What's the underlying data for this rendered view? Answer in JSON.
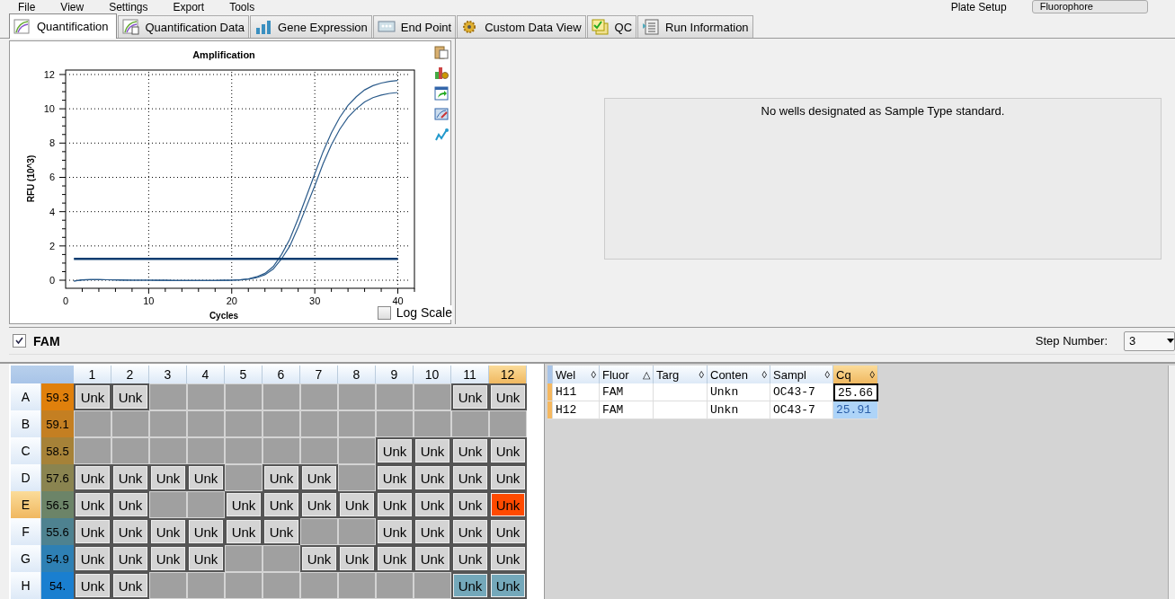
{
  "menu": [
    "File",
    "View",
    "Settings",
    "Export",
    "Tools"
  ],
  "plate_setup": "Plate Setup",
  "fluorophore": "Fluorophore",
  "tabs": [
    {
      "label": "Quantification",
      "selected": true
    },
    {
      "label": "Quantification Data",
      "selected": false
    },
    {
      "label": "Gene Expression",
      "selected": false
    },
    {
      "label": "End Point",
      "selected": false
    },
    {
      "label": "Custom Data View",
      "selected": false
    },
    {
      "label": "QC",
      "selected": false
    },
    {
      "label": "Run Information",
      "selected": false
    }
  ],
  "chart": {
    "log_scale": {
      "label": "Log Scale",
      "checked": false
    },
    "chart_data": {
      "type": "line",
      "title": "Amplification",
      "xlabel": "Cycles",
      "ylabel": "RFU (10^3)",
      "x": [
        1,
        2,
        3,
        4,
        5,
        6,
        7,
        8,
        9,
        10,
        11,
        12,
        13,
        14,
        15,
        16,
        17,
        18,
        19,
        20,
        21,
        22,
        23,
        24,
        25,
        26,
        27,
        28,
        29,
        30,
        31,
        32,
        33,
        34,
        35,
        36,
        37,
        38,
        39,
        40
      ],
      "grid": true,
      "xlim": [
        0,
        42
      ],
      "ylim": [
        -0.47,
        12.26
      ],
      "xticks": [
        0,
        10,
        20,
        30,
        40
      ],
      "yticks": [
        0,
        2,
        4,
        6,
        8,
        10,
        12
      ],
      "series": [
        {
          "color": "#2a5a8a",
          "values": [
            -0.05,
            0.02,
            0.04,
            0.04,
            0.03,
            0.02,
            0.01,
            0,
            0,
            0,
            -0.01,
            -0.01,
            -0.02,
            -0.02,
            -0.02,
            -0.02,
            -0.02,
            -0.02,
            -0.01,
            0,
            0.02,
            0.08,
            0.2,
            0.4,
            0.8,
            1.5,
            2.4,
            3.6,
            4.9,
            6.2,
            7.5,
            8.6,
            9.5,
            10.2,
            10.7,
            11.1,
            11.35,
            11.5,
            11.6,
            11.65
          ]
        },
        {
          "color": "#2a5a8a",
          "values": [
            -0.05,
            0.02,
            0.04,
            0.04,
            0.03,
            0.02,
            0.01,
            0,
            0,
            0,
            -0.01,
            -0.01,
            -0.02,
            -0.02,
            -0.02,
            -0.02,
            -0.02,
            -0.02,
            -0.01,
            0,
            0.02,
            0.06,
            0.15,
            0.32,
            0.65,
            1.25,
            2.0,
            3.1,
            4.3,
            5.5,
            6.8,
            7.9,
            8.8,
            9.5,
            10.0,
            10.4,
            10.65,
            10.8,
            10.9,
            10.95
          ]
        },
        {
          "color": "#0d3d70",
          "values": [
            1.25,
            1.25,
            1.25,
            1.25,
            1.25,
            1.25,
            1.25,
            1.25,
            1.25,
            1.25,
            1.25,
            1.25,
            1.25,
            1.25,
            1.25,
            1.25,
            1.25,
            1.25,
            1.25,
            1.25,
            1.25,
            1.25,
            1.25,
            1.25,
            1.25,
            1.25,
            1.25,
            1.25,
            1.25,
            1.25,
            1.25,
            1.25,
            1.25,
            1.25,
            1.25,
            1.25,
            1.25,
            1.25,
            1.25,
            1.25
          ]
        }
      ]
    }
  },
  "standard_message": "No wells designated as Sample Type standard.",
  "fluor_filter": {
    "label": "FAM",
    "checked": true
  },
  "step_number": {
    "label": "Step Number:",
    "value": "3"
  },
  "plate": {
    "columns": [
      {
        "label": "1",
        "selected": false
      },
      {
        "label": "2",
        "selected": false
      },
      {
        "label": "3",
        "selected": false
      },
      {
        "label": "4",
        "selected": false
      },
      {
        "label": "5",
        "selected": false
      },
      {
        "label": "6",
        "selected": false
      },
      {
        "label": "7",
        "selected": false
      },
      {
        "label": "8",
        "selected": false
      },
      {
        "label": "9",
        "selected": false
      },
      {
        "label": "10",
        "selected": false
      },
      {
        "label": "11",
        "selected": false
      },
      {
        "label": "12",
        "selected": true
      }
    ],
    "rows": [
      {
        "label": "A",
        "selected": false,
        "temp": "59.3",
        "color": "#e0800c",
        "wells": [
          {
            "kind": "sample",
            "label": "Unk",
            "selected": false,
            "focused": false
          },
          {
            "kind": "sample",
            "label": "Unk",
            "selected": false,
            "focused": false
          },
          {
            "kind": "empty"
          },
          {
            "kind": "empty"
          },
          {
            "kind": "empty"
          },
          {
            "kind": "empty"
          },
          {
            "kind": "empty"
          },
          {
            "kind": "empty"
          },
          {
            "kind": "empty"
          },
          {
            "kind": "empty"
          },
          {
            "kind": "sample",
            "label": "Unk",
            "selected": false,
            "focused": false
          },
          {
            "kind": "sample",
            "label": "Unk",
            "selected": false,
            "focused": false
          }
        ]
      },
      {
        "label": "B",
        "selected": false,
        "temp": "59.1",
        "color": "#c47f22",
        "wells": [
          {
            "kind": "empty"
          },
          {
            "kind": "empty"
          },
          {
            "kind": "empty"
          },
          {
            "kind": "empty"
          },
          {
            "kind": "empty"
          },
          {
            "kind": "empty"
          },
          {
            "kind": "empty"
          },
          {
            "kind": "empty"
          },
          {
            "kind": "empty"
          },
          {
            "kind": "empty"
          },
          {
            "kind": "empty"
          },
          {
            "kind": "empty"
          }
        ]
      },
      {
        "label": "C",
        "selected": false,
        "temp": "58.5",
        "color": "#a68238",
        "wells": [
          {
            "kind": "empty"
          },
          {
            "kind": "empty"
          },
          {
            "kind": "empty"
          },
          {
            "kind": "empty"
          },
          {
            "kind": "empty"
          },
          {
            "kind": "empty"
          },
          {
            "kind": "empty"
          },
          {
            "kind": "empty"
          },
          {
            "kind": "sample",
            "label": "Unk",
            "selected": false,
            "focused": false
          },
          {
            "kind": "sample",
            "label": "Unk",
            "selected": false,
            "focused": false
          },
          {
            "kind": "sample",
            "label": "Unk",
            "selected": false,
            "focused": false
          },
          {
            "kind": "sample",
            "label": "Unk",
            "selected": false,
            "focused": false
          }
        ]
      },
      {
        "label": "D",
        "selected": false,
        "temp": "57.6",
        "color": "#8a8450",
        "wells": [
          {
            "kind": "sample",
            "label": "Unk",
            "selected": false,
            "focused": false
          },
          {
            "kind": "sample",
            "label": "Unk",
            "selected": false,
            "focused": false
          },
          {
            "kind": "sample",
            "label": "Unk",
            "selected": false,
            "focused": false
          },
          {
            "kind": "sample",
            "label": "Unk",
            "selected": false,
            "focused": false
          },
          {
            "kind": "empty"
          },
          {
            "kind": "sample",
            "label": "Unk",
            "selected": false,
            "focused": false
          },
          {
            "kind": "sample",
            "label": "Unk",
            "selected": false,
            "focused": false
          },
          {
            "kind": "empty"
          },
          {
            "kind": "sample",
            "label": "Unk",
            "selected": false,
            "focused": false
          },
          {
            "kind": "sample",
            "label": "Unk",
            "selected": false,
            "focused": false
          },
          {
            "kind": "sample",
            "label": "Unk",
            "selected": false,
            "focused": false
          },
          {
            "kind": "sample",
            "label": "Unk",
            "selected": false,
            "focused": false
          }
        ]
      },
      {
        "label": "E",
        "selected": true,
        "temp": "56.5",
        "color": "#6c8468",
        "wells": [
          {
            "kind": "sample",
            "label": "Unk",
            "selected": false,
            "focused": false
          },
          {
            "kind": "sample",
            "label": "Unk",
            "selected": false,
            "focused": false
          },
          {
            "kind": "empty"
          },
          {
            "kind": "empty"
          },
          {
            "kind": "sample",
            "label": "Unk",
            "selected": false,
            "focused": false
          },
          {
            "kind": "sample",
            "label": "Unk",
            "selected": false,
            "focused": false
          },
          {
            "kind": "sample",
            "label": "Unk",
            "selected": false,
            "focused": false
          },
          {
            "kind": "sample",
            "label": "Unk",
            "selected": false,
            "focused": false
          },
          {
            "kind": "sample",
            "label": "Unk",
            "selected": false,
            "focused": false
          },
          {
            "kind": "sample",
            "label": "Unk",
            "selected": false,
            "focused": false
          },
          {
            "kind": "sample",
            "label": "Unk",
            "selected": false,
            "focused": false
          },
          {
            "kind": "sample",
            "label": "Unk",
            "selected": false,
            "focused": true
          }
        ]
      },
      {
        "label": "F",
        "selected": false,
        "temp": "55.6",
        "color": "#4e8290",
        "wells": [
          {
            "kind": "sample",
            "label": "Unk",
            "selected": false,
            "focused": false
          },
          {
            "kind": "sample",
            "label": "Unk",
            "selected": false,
            "focused": false
          },
          {
            "kind": "sample",
            "label": "Unk",
            "selected": false,
            "focused": false
          },
          {
            "kind": "sample",
            "label": "Unk",
            "selected": false,
            "focused": false
          },
          {
            "kind": "sample",
            "label": "Unk",
            "selected": false,
            "focused": false
          },
          {
            "kind": "sample",
            "label": "Unk",
            "selected": false,
            "focused": false
          },
          {
            "kind": "empty"
          },
          {
            "kind": "empty"
          },
          {
            "kind": "sample",
            "label": "Unk",
            "selected": false,
            "focused": false
          },
          {
            "kind": "sample",
            "label": "Unk",
            "selected": false,
            "focused": false
          },
          {
            "kind": "sample",
            "label": "Unk",
            "selected": false,
            "focused": false
          },
          {
            "kind": "sample",
            "label": "Unk",
            "selected": false,
            "focused": false
          }
        ]
      },
      {
        "label": "G",
        "selected": false,
        "temp": "54.9",
        "color": "#2e80b4",
        "wells": [
          {
            "kind": "sample",
            "label": "Unk",
            "selected": false,
            "focused": false
          },
          {
            "kind": "sample",
            "label": "Unk",
            "selected": false,
            "focused": false
          },
          {
            "kind": "sample",
            "label": "Unk",
            "selected": false,
            "focused": false
          },
          {
            "kind": "sample",
            "label": "Unk",
            "selected": false,
            "focused": false
          },
          {
            "kind": "empty"
          },
          {
            "kind": "empty"
          },
          {
            "kind": "sample",
            "label": "Unk",
            "selected": false,
            "focused": false
          },
          {
            "kind": "sample",
            "label": "Unk",
            "selected": false,
            "focused": false
          },
          {
            "kind": "sample",
            "label": "Unk",
            "selected": false,
            "focused": false
          },
          {
            "kind": "sample",
            "label": "Unk",
            "selected": false,
            "focused": false
          },
          {
            "kind": "sample",
            "label": "Unk",
            "selected": false,
            "focused": false
          },
          {
            "kind": "sample",
            "label": "Unk",
            "selected": false,
            "focused": false
          }
        ]
      },
      {
        "label": "H",
        "selected": false,
        "temp": "54.",
        "color": "#1a7fd0",
        "wells": [
          {
            "kind": "sample",
            "label": "Unk",
            "selected": false,
            "focused": false
          },
          {
            "kind": "sample",
            "label": "Unk",
            "selected": false,
            "focused": false
          },
          {
            "kind": "empty"
          },
          {
            "kind": "empty"
          },
          {
            "kind": "empty"
          },
          {
            "kind": "empty"
          },
          {
            "kind": "empty"
          },
          {
            "kind": "empty"
          },
          {
            "kind": "empty"
          },
          {
            "kind": "empty"
          },
          {
            "kind": "sample",
            "label": "Unk",
            "selected": true,
            "focused": false
          },
          {
            "kind": "sample",
            "label": "Unk",
            "selected": true,
            "focused": false
          }
        ]
      }
    ]
  },
  "table": {
    "columns": [
      {
        "label": "Wel",
        "sort": "◊"
      },
      {
        "label": "Fluor",
        "sort": "△"
      },
      {
        "label": "Targ",
        "sort": "◊"
      },
      {
        "label": "Conten",
        "sort": "◊"
      },
      {
        "label": "Sampl",
        "sort": "◊"
      },
      {
        "label": "Cq",
        "sort": "◊"
      }
    ],
    "rows": [
      {
        "well": "H11",
        "fluor": "FAM",
        "content": "Unkn",
        "sample": "OC43-7",
        "cq": "25.66",
        "focused": true
      },
      {
        "well": "H12",
        "fluor": "FAM",
        "content": "Unkn",
        "sample": "OC43-7",
        "cq": "25.91",
        "focused": false
      }
    ]
  }
}
